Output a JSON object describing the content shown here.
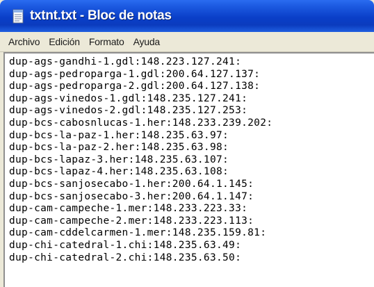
{
  "window": {
    "title": "txtnt.txt - Bloc de notas",
    "app_icon": "notepad-icon"
  },
  "menu": [
    {
      "label": "Archivo"
    },
    {
      "label": "Edición"
    },
    {
      "label": "Formato"
    },
    {
      "label": "Ayuda"
    }
  ],
  "document": {
    "lines": [
      "dup-ags-gandhi-1.gdl:148.223.127.241:",
      "dup-ags-pedroparga-1.gdl:200.64.127.137:",
      "dup-ags-pedroparga-2.gdl:200.64.127.138:",
      "dup-ags-vinedos-1.gdl:148.235.127.241:",
      "dup-ags-vinedos-2.gdl:148.235.127.253:",
      "dup-bcs-cabosnlucas-1.her:148.233.239.202:",
      "dup-bcs-la-paz-1.her:148.235.63.97:",
      "dup-bcs-la-paz-2.her:148.235.63.98:",
      "dup-bcs-lapaz-3.her:148.235.63.107:",
      "dup-bcs-lapaz-4.her:148.235.63.108:",
      "dup-bcs-sanjosecabo-1.her:200.64.1.145:",
      "dup-bcs-sanjosecabo-3.her:200.64.1.147:",
      "dup-cam-campeche-1.mer:148.233.223.33:",
      "dup-cam-campeche-2.mer:148.233.223.113:",
      "dup-cam-cddelcarmen-1.mer:148.235.159.81:",
      "dup-chi-catedral-1.chi:148.235.63.49:",
      "dup-chi-catedral-2.chi:148.235.63.50:"
    ]
  },
  "colors": {
    "titlebar": "#0a3fc8",
    "menubar": "#ece9d8",
    "editor_background": "#ffffff"
  }
}
